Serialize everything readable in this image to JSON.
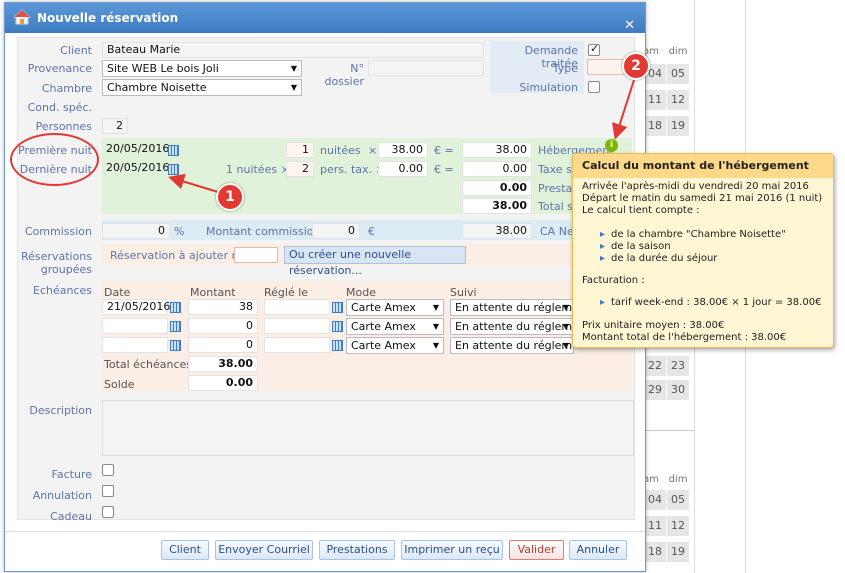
{
  "dialog": {
    "title": "Nouvelle réservation"
  },
  "labels": {
    "client": "Client",
    "provenance": "Provenance",
    "chambre": "Chambre",
    "cond_spec": "Cond. spéc.",
    "personnes": "Personnes",
    "premiere_nuit": "Première nuit",
    "derniere_nuit": "Dernière nuit",
    "commission": "Commission",
    "reservations_groupees_1": "Réservations",
    "reservations_groupees_2": "groupées",
    "echeances": "Echéances",
    "description": "Description",
    "facture": "Facture",
    "annulation": "Annulation",
    "cadeau": "Cadeau",
    "demande_traitee": "Demande traitée",
    "type": "Type",
    "simulation": "Simulation",
    "no_dossier": "N° dossier",
    "nuitees": "nuitées",
    "nuitees_2": "1 nuitées ×",
    "pers_tax": "pers. tax. ×",
    "times": "×",
    "euro_eq": "€ =",
    "hebergement": "Hébergement",
    "taxe": "Taxe sé",
    "prestation": "Prestati",
    "total_se": "Total sé",
    "percent": "%",
    "montant_commission": "Montant commission",
    "euro": "€",
    "ca_net": "CA Net",
    "reservation_a_ajouter": "Réservation à ajouter n°",
    "ou_creer": "Ou créer une nouvelle réservation...",
    "col_date": "Date",
    "col_montant": "Montant",
    "col_regle_le": "Réglé le",
    "col_mode": "Mode",
    "col_suivi": "Suivi",
    "total_echeances": "Total échéances",
    "solde": "Solde"
  },
  "values": {
    "client": "Bateau Marie",
    "provenance": "Site WEB Le bois Joli",
    "chambre": "Chambre Noisette",
    "personnes": "2",
    "premiere_nuit": "20/05/2016",
    "derniere_nuit": "20/05/2016",
    "nuitees": "1",
    "prix_nuit": "38.00",
    "total_heb": "38.00",
    "pers_tax": "2",
    "taxe_prix": "0.00",
    "taxe_total": "0.00",
    "prestations_total": "0.00",
    "total_sejour": "38.00",
    "commission_pct": "0",
    "montant_commission": "0",
    "ca_net": "38.00",
    "total_echeances": "38.00",
    "solde": "0.00",
    "demande_traitee": true
  },
  "echeances": [
    {
      "date": "21/05/2016",
      "montant": "38",
      "regle": "",
      "mode": "Carte Amex",
      "suivi": "En attente du réglem"
    },
    {
      "date": "",
      "montant": "0",
      "regle": "",
      "mode": "Carte Amex",
      "suivi": "En attente du réglem"
    },
    {
      "date": "",
      "montant": "0",
      "regle": "",
      "mode": "Carte Amex",
      "suivi": "En attente du réglem"
    }
  ],
  "buttons": {
    "client": "Client",
    "envoyer": "Envoyer Courriel",
    "prestations": "Prestations",
    "imprimer": "Imprimer un reçu",
    "valider": "Valider",
    "annuler": "Annuler"
  },
  "tooltip": {
    "title": "Calcul du montant de l'hébergement",
    "line1": "Arrivée l'après-midi du vendredi 20 mai 2016",
    "line2": "Départ le matin du samedi 21 mai 2016 (1 nuit)",
    "line3": "Le calcul tient compte :",
    "bullet1": "de la chambre \"Chambre Noisette\"",
    "bullet2": "de la saison",
    "bullet3": "de la durée du séjour",
    "facturation": "Facturation :",
    "tarif": "tarif week-end : 38.00€ × 1 jour = 38.00€",
    "prix_moyen": "Prix unitaire moyen : 38.00€",
    "montant_total": "Montant total de l'hébergement : 38.00€"
  },
  "annotations": {
    "badge1": "1",
    "badge2": "2"
  },
  "calendar": {
    "header1": [
      "am",
      "dim"
    ],
    "col_dim": [
      "05",
      "12",
      "19"
    ],
    "col_sam": [
      "04",
      "11",
      "18"
    ],
    "lower_a": [
      "22",
      "29"
    ],
    "lower_b": [
      "23",
      "30"
    ],
    "header2": [
      "am",
      "dim"
    ],
    "col2_sam": [
      "04",
      "11",
      "18"
    ],
    "col2_dim": [
      "05",
      "12",
      "19"
    ]
  },
  "colors": {
    "accent": "#3d7bc2",
    "annotation": "#e23a32",
    "tooltip_bg": "#fff6d3"
  }
}
